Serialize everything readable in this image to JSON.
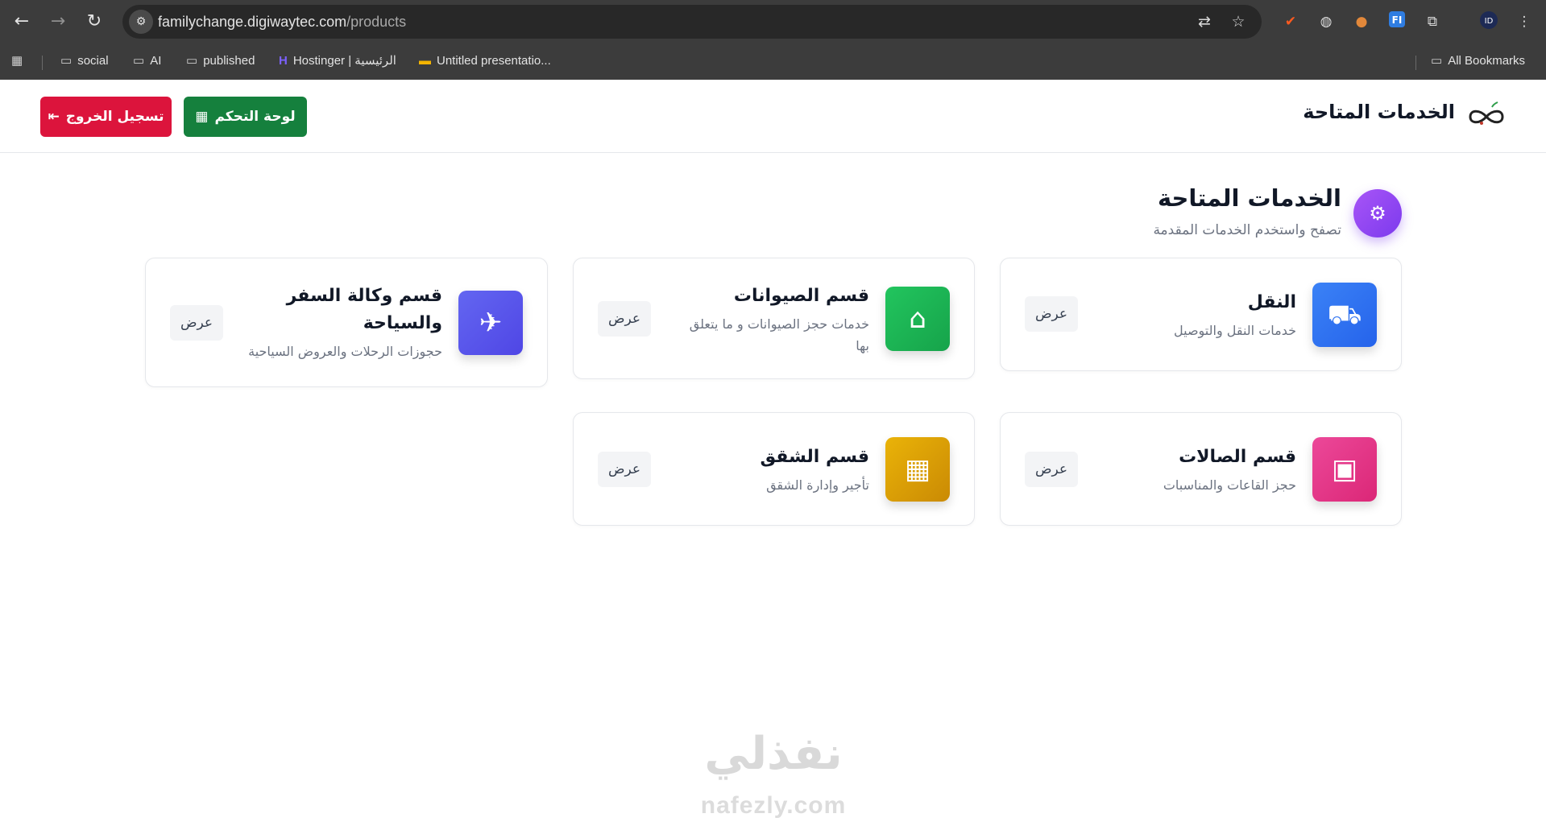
{
  "browser": {
    "url_host": "familychange.digiwaytec.com",
    "url_path": "/products",
    "bookmarks": [
      {
        "label": "social",
        "icon": "folder-icon"
      },
      {
        "label": "AI",
        "icon": "folder-icon"
      },
      {
        "label": "published",
        "icon": "folder-icon"
      },
      {
        "label": "Hostinger | الرئيسية",
        "icon": "hostinger-icon"
      },
      {
        "label": "Untitled presentatio...",
        "icon": "slides-icon"
      }
    ],
    "all_bookmarks_label": "All Bookmarks"
  },
  "header": {
    "brand_title": "الخدمات المتاحة",
    "dashboard_label": "لوحة التحكم",
    "logout_label": "تسجيل الخروج"
  },
  "section": {
    "title": "الخدمات المتاحة",
    "subtitle": "تصفح واستخدم الخدمات المقدمة"
  },
  "cards": [
    {
      "title": "النقل",
      "desc": "خدمات النقل والتوصيل",
      "view": "عرض",
      "icon": "truck-icon",
      "color": "#3b82f6"
    },
    {
      "title": "قسم الصيوانات",
      "desc": "خدمات حجز الصيوانات و ما يتعلق بها",
      "view": "عرض",
      "icon": "tent-icon",
      "color": "#22c55e"
    },
    {
      "title": "قسم وكالة السفر والسياحة",
      "desc": "حجوزات الرحلات والعروض السياحية",
      "view": "عرض",
      "icon": "plane-icon",
      "color": "#6366f1"
    },
    {
      "title": "قسم الصالات",
      "desc": "حجز القاعات والمناسبات",
      "view": "عرض",
      "icon": "calendar-icon",
      "color": "#ec4899"
    },
    {
      "title": "قسم الشقق",
      "desc": "تأجير وإدارة الشقق",
      "view": "عرض",
      "icon": "building-icon",
      "color": "#eab308"
    }
  ],
  "watermark": {
    "arabic": "نفذلي",
    "latin": "nafezly.com"
  }
}
